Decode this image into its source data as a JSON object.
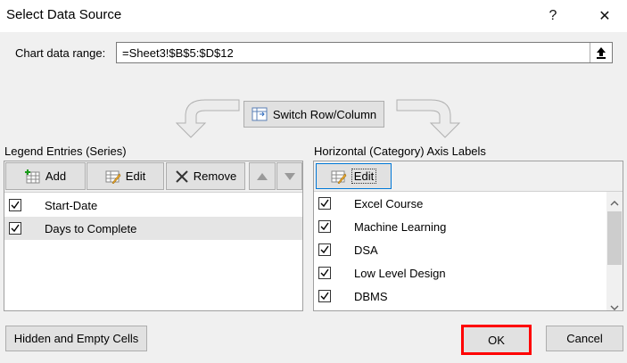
{
  "title": "Select Data Source",
  "window_buttons": {
    "help": "?",
    "close": "✕"
  },
  "chart_range": {
    "label": "Chart data range:",
    "value": "=Sheet3!$B$5:$D$12"
  },
  "switch_button": "Switch Row/Column",
  "legend": {
    "header": "Legend Entries (Series)",
    "add": "Add",
    "edit": "Edit",
    "remove": "Remove",
    "items": [
      {
        "label": "Start-Date",
        "checked": true,
        "selected": false
      },
      {
        "label": "Days to Complete",
        "checked": true,
        "selected": true
      }
    ]
  },
  "axis": {
    "header": "Horizontal (Category) Axis Labels",
    "edit": "Edit",
    "items": [
      {
        "label": "Excel Course",
        "checked": true
      },
      {
        "label": "Machine Learning",
        "checked": true
      },
      {
        "label": "DSA",
        "checked": true
      },
      {
        "label": "Low Level Design",
        "checked": true
      },
      {
        "label": "DBMS",
        "checked": true
      }
    ]
  },
  "footer": {
    "hidden_cells": "Hidden and Empty Cells",
    "ok": "OK",
    "cancel": "Cancel"
  },
  "colors": {
    "highlight": "#ff0000",
    "selected_row": "#e5e5e5",
    "edit_focus": "#0078d7"
  }
}
